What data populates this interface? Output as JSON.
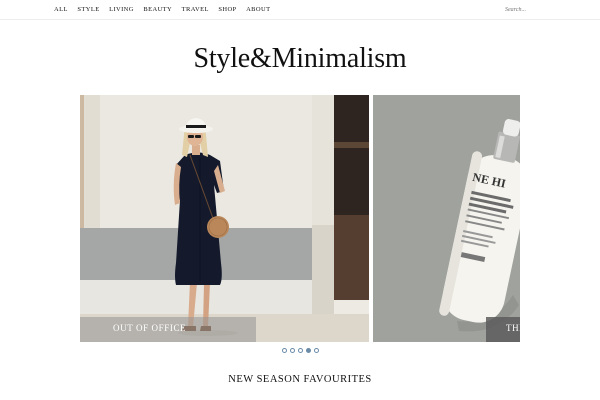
{
  "nav": {
    "items": [
      {
        "label": "ALL"
      },
      {
        "label": "STYLE"
      },
      {
        "label": "LIVING"
      },
      {
        "label": "BEAUTY"
      },
      {
        "label": "TRAVEL"
      },
      {
        "label": "SHOP"
      },
      {
        "label": "ABOUT"
      }
    ]
  },
  "search": {
    "placeholder": "Search..."
  },
  "site": {
    "title": "Style&Minimalism"
  },
  "carousel": {
    "slides": [
      {
        "caption": "OUT OF OFFICE"
      },
      {
        "caption": "THE"
      }
    ],
    "dot_count": 5,
    "active_dot": 3
  },
  "section": {
    "title": "NEW SEASON FAVOURITES"
  },
  "colors": {
    "dot_accent": "#6a8aa6",
    "dress": "#141a2c",
    "bag": "#b9875a"
  }
}
